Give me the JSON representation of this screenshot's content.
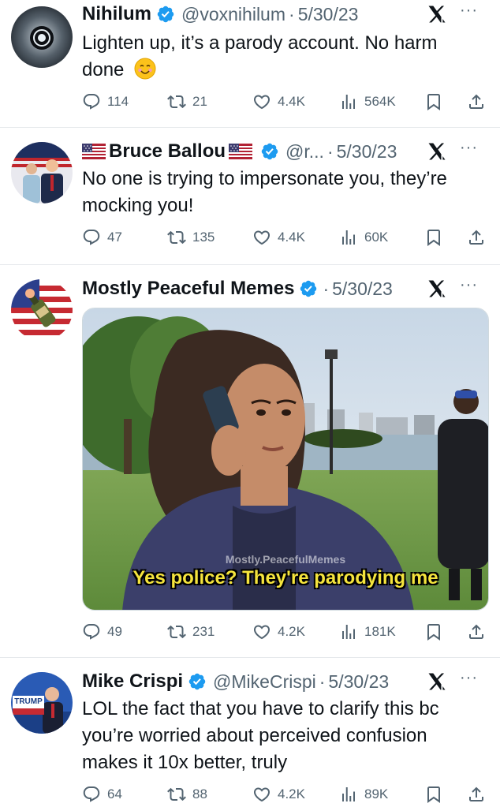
{
  "tweets": [
    {
      "name": "Nihilum",
      "handle": "@voxnihilum",
      "sep": "·",
      "date": "5/30/23",
      "text_lines": [
        "Lighten up, it’s a parody account. No harm",
        "done"
      ],
      "replies": "114",
      "reposts": "21",
      "likes": "4.4K",
      "views": "564K"
    },
    {
      "name": "Bruce Ballou",
      "handle": "@r...",
      "sep": "·",
      "date": "5/30/23",
      "text_lines": [
        "No one is trying to impersonate you, they’re",
        "mocking you!"
      ],
      "replies": "47",
      "reposts": "135",
      "likes": "4.4K",
      "views": "60K"
    },
    {
      "name": "Mostly Peaceful Memes",
      "sep": "·",
      "date": "5/30/23",
      "media": {
        "watermark": "Mostly.PeacefulMemes",
        "caption": "Yes police? They're parodying me"
      },
      "replies": "49",
      "reposts": "231",
      "likes": "4.2K",
      "views": "181K"
    },
    {
      "name": "Mike Crispi",
      "handle": "@MikeCrispi",
      "sep": "·",
      "date": "5/30/23",
      "avatar_sign": "TRUMP",
      "text_lines": [
        "LOL the fact that you have to clarify this bc",
        "you’re worried about perceived confusion",
        "makes it 10x better, truly"
      ],
      "replies": "64",
      "reposts": "88",
      "likes": "4.2K",
      "views": "89K"
    }
  ],
  "more_label": "···",
  "colors": {
    "verified": "#1d9bf0",
    "secondary": "#536471",
    "primary": "#0f1419"
  }
}
